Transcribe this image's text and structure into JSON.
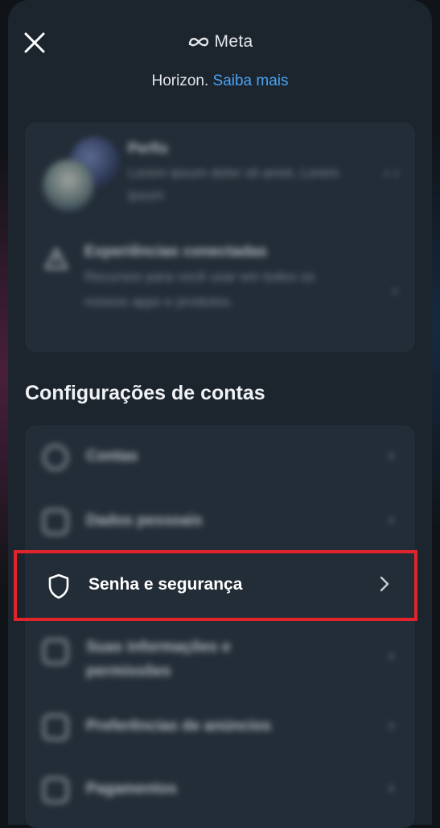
{
  "header": {
    "brand": "Meta",
    "subtitle_text": "Horizon.",
    "subtitle_link": "Saiba mais"
  },
  "profiles": {
    "title": "Perfis",
    "description": "Lorem ipsum dolor sit amet, Lorem ipsum",
    "arrows": "‹ ›"
  },
  "connected": {
    "title": "Experiências conectadas",
    "description": "Recursos para você usar em todos os nossos apps e produtos.",
    "chevron": "›"
  },
  "section": {
    "title": "Configurações de contas"
  },
  "settings": {
    "items": [
      {
        "label": "Contas",
        "chevron": "›"
      },
      {
        "label": "Dados pessoais",
        "chevron": "›"
      },
      {
        "label": "Senha e segurança"
      },
      {
        "label": "Suas informações e permissões",
        "chevron": "›"
      },
      {
        "label": "Preferências de anúncios",
        "chevron": "›"
      },
      {
        "label": "Pagamentos",
        "chevron": "›"
      }
    ]
  },
  "colors": {
    "accent_link": "#4aa3f5",
    "highlight": "#e1242c",
    "panel": "#1c252e"
  }
}
